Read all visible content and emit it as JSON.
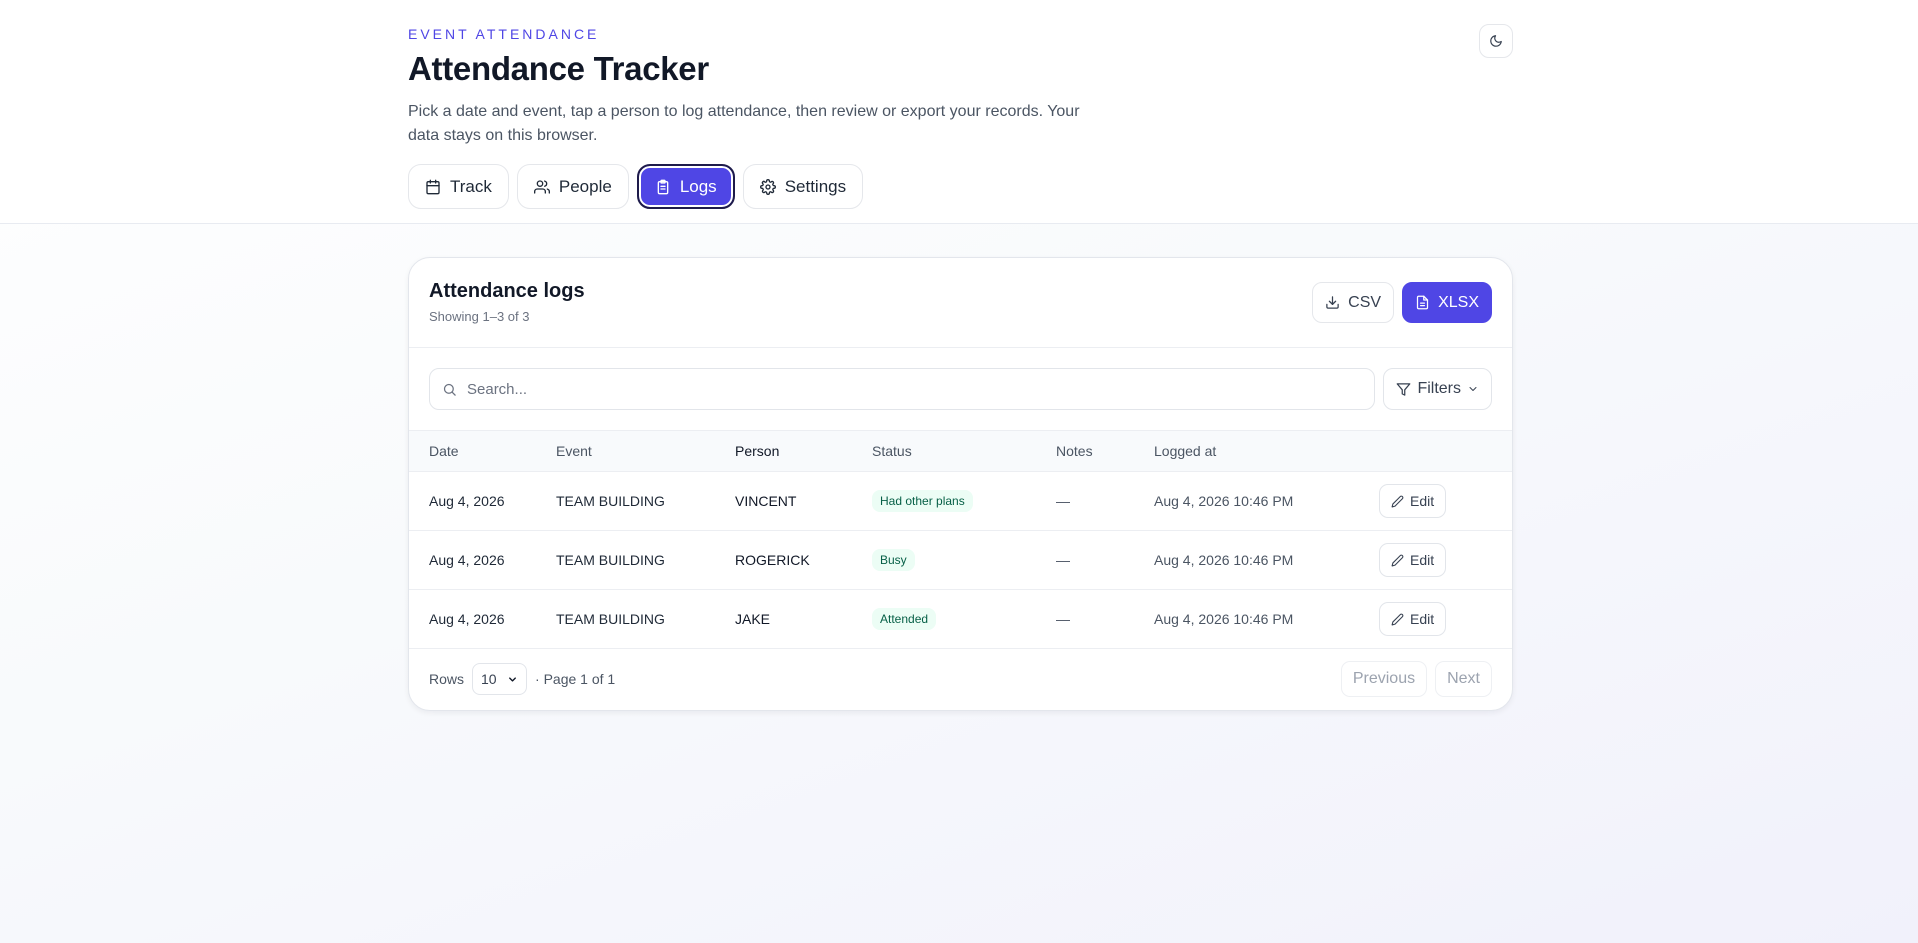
{
  "header": {
    "eyebrow": "EVENT ATTENDANCE",
    "title": "Attendance Tracker",
    "description": "Pick a date and event, tap a person to log attendance, then review or export your records. Your data stays on this browser."
  },
  "tabs": [
    {
      "label": "Track",
      "icon": "calendar-icon"
    },
    {
      "label": "People",
      "icon": "users-icon"
    },
    {
      "label": "Logs",
      "icon": "clipboard-icon",
      "active": true
    },
    {
      "label": "Settings",
      "icon": "gear-icon"
    }
  ],
  "logs": {
    "title": "Attendance logs",
    "subtitle": "Showing 1–3 of 3",
    "csv_label": "CSV",
    "xlsx_label": "XLSX",
    "search_placeholder": "Search...",
    "filters_label": "Filters",
    "columns": [
      "Date",
      "Event",
      "Person",
      "Status",
      "Notes",
      "Logged at"
    ],
    "rows": [
      {
        "date": "Aug 4, 2026",
        "event": "TEAM BUILDING",
        "person": "VINCENT",
        "status": "Had other plans",
        "notes": "—",
        "logged_at": "Aug 4, 2026 10:46 PM",
        "action": "Edit"
      },
      {
        "date": "Aug 4, 2026",
        "event": "TEAM BUILDING",
        "person": "ROGERICK",
        "status": "Busy",
        "notes": "—",
        "logged_at": "Aug 4, 2026 10:46 PM",
        "action": "Edit"
      },
      {
        "date": "Aug 4, 2026",
        "event": "TEAM BUILDING",
        "person": "JAKE",
        "status": "Attended",
        "notes": "—",
        "logged_at": "Aug 4, 2026 10:46 PM",
        "action": "Edit"
      }
    ],
    "rows_label": "Rows",
    "rows_value": "10",
    "page_info": "· Page 1 of 1",
    "previous_label": "Previous",
    "next_label": "Next"
  },
  "colors": {
    "accent": "#4f46e5",
    "badge_bg": "#ecfdf5",
    "badge_text": "#065f46"
  }
}
